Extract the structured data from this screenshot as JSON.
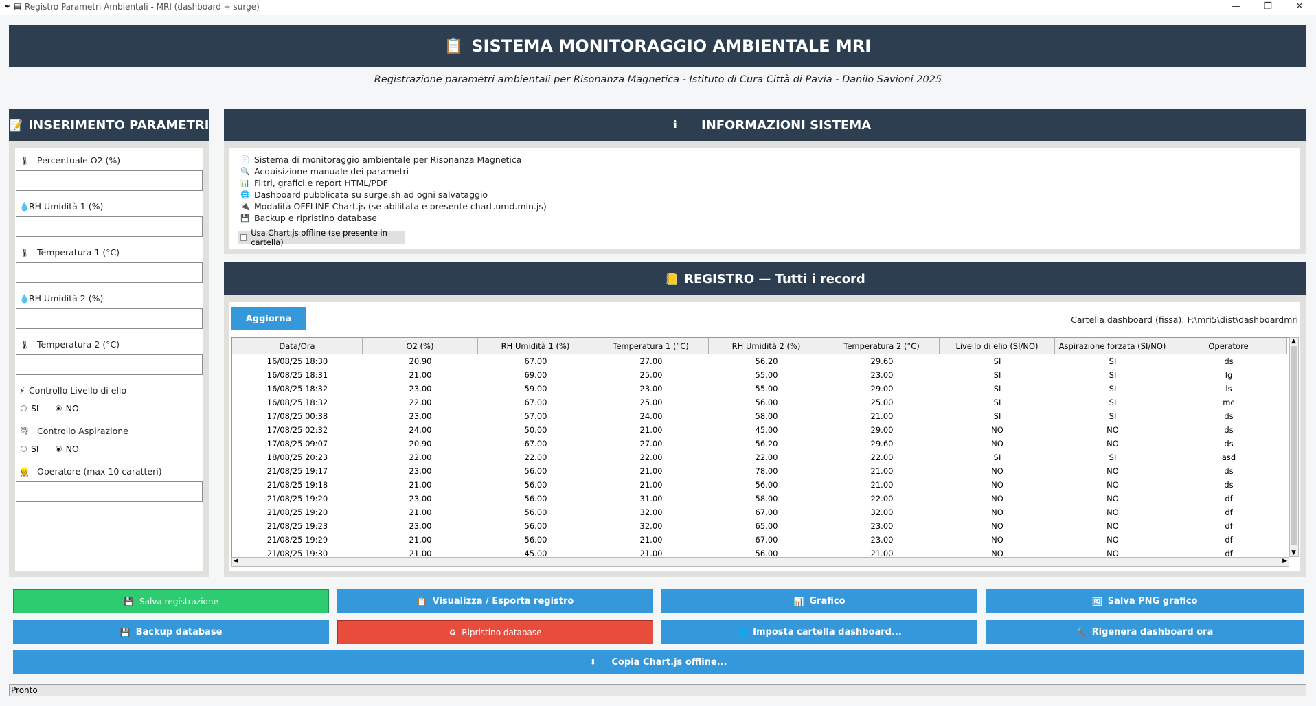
{
  "window": {
    "title": "Registro Parametri Ambientali - MRI (dashboard + surge)",
    "minimize": "—",
    "restore": "❐",
    "close": "✕"
  },
  "header": {
    "title": "SISTEMA MONITORAGGIO AMBIENTALE MRI",
    "subtitle": "Registrazione parametri ambientali per Risonanza Magnetica - Istituto di Cura Città di Pavia - Danilo Savioni 2025"
  },
  "left_panel": {
    "title": "INSERIMENTO PARAMETRI",
    "fields": {
      "o2": {
        "label": "Percentuale O2 (%)",
        "value": ""
      },
      "rh1": {
        "label": "RH Umidità 1 (%)",
        "value": ""
      },
      "temp1": {
        "label": "Temperatura 1 (°C)",
        "value": ""
      },
      "rh2": {
        "label": "RH Umidità 2 (%)",
        "value": ""
      },
      "temp2": {
        "label": "Temperatura 2 (°C)",
        "value": ""
      },
      "operatore": {
        "label": "Operatore (max 10 caratteri)",
        "value": ""
      }
    },
    "elio": {
      "label": "Controllo Livello di elio",
      "yes": "SI",
      "no": "NO",
      "selected": "NO"
    },
    "aspirazione": {
      "label": "Controllo Aspirazione",
      "yes": "SI",
      "no": "NO",
      "selected": "NO"
    }
  },
  "info_panel": {
    "title": "INFORMAZIONI SISTEMA",
    "lines": [
      "Sistema di monitoraggio ambientale per Risonanza Magnetica",
      "Acquisizione manuale dei parametri",
      "Filtri, grafici e report HTML/PDF",
      "Dashboard pubblicata su surge.sh ad ogni salvataggio",
      "Modalità OFFLINE Chart.js (se abilitata e presente chart.umd.min.js)",
      "Backup e ripristino database"
    ],
    "checkbox_label": "Usa Chart.js offline (se presente in cartella)"
  },
  "registro": {
    "title": "REGISTRO — Tutti i record",
    "refresh_label": "Aggiorna",
    "folder_text": "Cartella dashboard (fissa): F:\\mri5\\dist\\dashboardmri",
    "columns": [
      "Data/Ora",
      "O2 (%)",
      "RH Umidità 1 (%)",
      "Temperatura 1 (°C)",
      "RH Umidità 2 (%)",
      "Temperatura 2 (°C)",
      "Livello di elio (SI/NO)",
      "Aspirazione forzata (SI/NO)",
      "Operatore"
    ],
    "rows": [
      [
        "16/08/25 18:30",
        "20.90",
        "67.00",
        "27.00",
        "56.20",
        "29.60",
        "SI",
        "SI",
        "ds"
      ],
      [
        "16/08/25 18:31",
        "21.00",
        "69.00",
        "25.00",
        "55.00",
        "23.00",
        "SI",
        "SI",
        "lg"
      ],
      [
        "16/08/25 18:32",
        "23.00",
        "59.00",
        "23.00",
        "55.00",
        "29.00",
        "SI",
        "SI",
        "ls"
      ],
      [
        "16/08/25 18:32",
        "22.00",
        "67.00",
        "25.00",
        "56.00",
        "25.00",
        "SI",
        "SI",
        "mc"
      ],
      [
        "17/08/25 00:38",
        "23.00",
        "57.00",
        "24.00",
        "58.00",
        "21.00",
        "SI",
        "SI",
        "ds"
      ],
      [
        "17/08/25 02:32",
        "24.00",
        "50.00",
        "21.00",
        "45.00",
        "29.00",
        "NO",
        "NO",
        "ds"
      ],
      [
        "17/08/25 09:07",
        "20.90",
        "67.00",
        "27.00",
        "56.20",
        "29.60",
        "NO",
        "NO",
        "ds"
      ],
      [
        "18/08/25 20:23",
        "22.00",
        "22.00",
        "22.00",
        "22.00",
        "22.00",
        "SI",
        "SI",
        "asd"
      ],
      [
        "21/08/25 19:17",
        "23.00",
        "56.00",
        "21.00",
        "78.00",
        "21.00",
        "NO",
        "NO",
        "ds"
      ],
      [
        "21/08/25 19:18",
        "21.00",
        "56.00",
        "21.00",
        "56.00",
        "21.00",
        "NO",
        "NO",
        "ds"
      ],
      [
        "21/08/25 19:20",
        "23.00",
        "56.00",
        "31.00",
        "58.00",
        "22.00",
        "NO",
        "NO",
        "df"
      ],
      [
        "21/08/25 19:20",
        "21.00",
        "56.00",
        "32.00",
        "67.00",
        "32.00",
        "NO",
        "NO",
        "df"
      ],
      [
        "21/08/25 19:23",
        "23.00",
        "56.00",
        "32.00",
        "65.00",
        "23.00",
        "NO",
        "NO",
        "df"
      ],
      [
        "21/08/25 19:29",
        "21.00",
        "56.00",
        "21.00",
        "67.00",
        "23.00",
        "NO",
        "NO",
        "df"
      ],
      [
        "21/08/25 19:30",
        "21.00",
        "45.00",
        "21.00",
        "56.00",
        "21.00",
        "NO",
        "NO",
        "df"
      ]
    ]
  },
  "buttons": {
    "salva": "Salva registrazione",
    "visualizza": "Visualizza / Esporta registro",
    "grafico": "Grafico",
    "salva_png": "Salva PNG grafico",
    "backup": "Backup database",
    "ripristino": "Ripristino database",
    "imposta": "Imposta cartella dashboard...",
    "rigenera": "Rigenera dashboard ora",
    "copia": "Copia Chart.js offline..."
  },
  "status": {
    "text": "Pronto"
  },
  "colors": {
    "header_bg": "#2c3e50",
    "button_blue": "#3498db",
    "button_green": "#2ecc71",
    "button_red": "#e74c3c"
  }
}
